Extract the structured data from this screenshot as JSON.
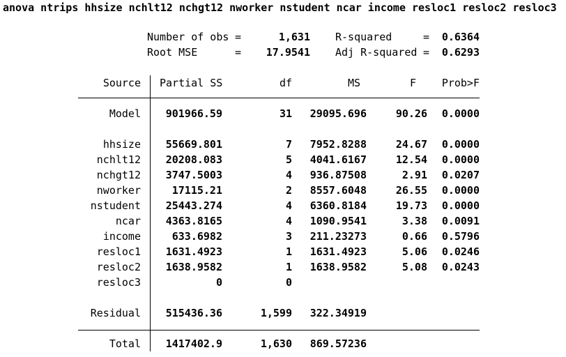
{
  "command": "anova ntrips hhsize nchlt12 nchgt12 nworker nstudent ncar income resloc1 resloc2 resloc3",
  "stats": {
    "nobs_label": "Number of obs",
    "nobs_value": "1,631",
    "rsq_label": "R-squared",
    "rsq_value": "0.6364",
    "rmse_label": "Root MSE",
    "rmse_value": "17.9541",
    "adjrsq_label": "Adj R-squared",
    "adjrsq_value": "0.6293",
    "eq": "="
  },
  "headers": [
    "Source",
    "Partial SS",
    "df",
    "MS",
    "F",
    "Prob>F"
  ],
  "rows": [
    {
      "source": "Model",
      "ss": "901966.59",
      "df": "31",
      "ms": "29095.696",
      "f": "90.26",
      "p": "0.0000"
    },
    {
      "source": "hhsize",
      "ss": "55669.801",
      "df": "7",
      "ms": "7952.8288",
      "f": "24.67",
      "p": "0.0000"
    },
    {
      "source": "nchlt12",
      "ss": "20208.083",
      "df": "5",
      "ms": "4041.6167",
      "f": "12.54",
      "p": "0.0000"
    },
    {
      "source": "nchgt12",
      "ss": "3747.5003",
      "df": "4",
      "ms": "936.87508",
      "f": "2.91",
      "p": "0.0207"
    },
    {
      "source": "nworker",
      "ss": "17115.21",
      "df": "2",
      "ms": "8557.6048",
      "f": "26.55",
      "p": "0.0000"
    },
    {
      "source": "nstudent",
      "ss": "25443.274",
      "df": "4",
      "ms": "6360.8184",
      "f": "19.73",
      "p": "0.0000"
    },
    {
      "source": "ncar",
      "ss": "4363.8165",
      "df": "4",
      "ms": "1090.9541",
      "f": "3.38",
      "p": "0.0091"
    },
    {
      "source": "income",
      "ss": "633.6982",
      "df": "3",
      "ms": "211.23273",
      "f": "0.66",
      "p": "0.5796"
    },
    {
      "source": "resloc1",
      "ss": "1631.4923",
      "df": "1",
      "ms": "1631.4923",
      "f": "5.06",
      "p": "0.0246"
    },
    {
      "source": "resloc2",
      "ss": "1638.9582",
      "df": "1",
      "ms": "1638.9582",
      "f": "5.08",
      "p": "0.0243"
    },
    {
      "source": "resloc3",
      "ss": "0",
      "df": "0",
      "ms": "",
      "f": "",
      "p": ""
    },
    {
      "source": "Residual",
      "ss": "515436.36",
      "df": "1,599",
      "ms": "322.34919",
      "f": "",
      "p": ""
    },
    {
      "source": "Total",
      "ss": "1417402.9",
      "df": "1,630",
      "ms": "869.57236",
      "f": "",
      "p": ""
    }
  ]
}
